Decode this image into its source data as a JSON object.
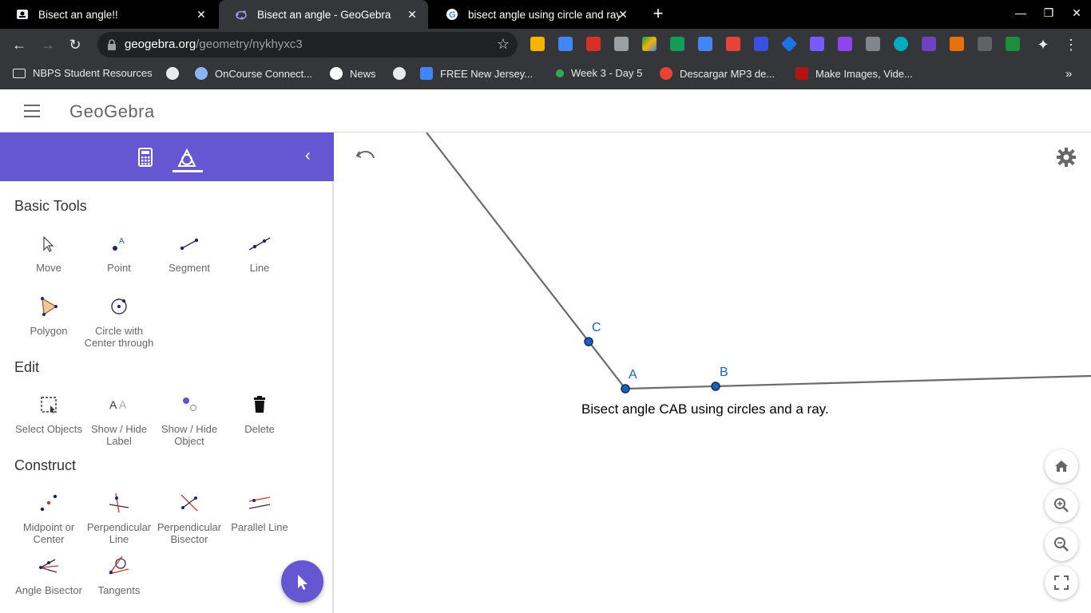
{
  "browser": {
    "tabs": [
      {
        "title": "Bisect an angle!!",
        "active": false
      },
      {
        "title": "Bisect an angle - GeoGebra",
        "active": true
      },
      {
        "title": "bisect angle using circle and ray",
        "active": false
      }
    ],
    "address": {
      "host": "geogebra.org",
      "path": "/geometry/nykhyxc3"
    },
    "bookmarks": [
      {
        "label": "NBPS Student Resources",
        "icon": "folder-icon"
      },
      {
        "label": "",
        "icon": "globe-icon"
      },
      {
        "label": "OnCourse Connect...",
        "icon": "cloud-icon"
      },
      {
        "label": "News",
        "icon": "google-icon"
      },
      {
        "label": "",
        "icon": "globe-icon"
      },
      {
        "label": "FREE New Jersey...",
        "icon": "shield-icon"
      },
      {
        "label": "Week 3 - Day 5",
        "icon": "leaf-icon"
      },
      {
        "label": "Descargar MP3 de...",
        "icon": "music-icon"
      },
      {
        "label": "Make Images, Vide...",
        "icon": "sp-icon"
      }
    ],
    "bookmarks_overflow": "»"
  },
  "app": {
    "logo": "GeoGebra"
  },
  "panel": {
    "sections": [
      {
        "title": "Basic Tools",
        "tools": [
          {
            "label": "Move",
            "icon": "move-icon"
          },
          {
            "label": "Point",
            "icon": "point-icon"
          },
          {
            "label": "Segment",
            "icon": "segment-icon"
          },
          {
            "label": "Line",
            "icon": "line-icon"
          },
          {
            "label": "Polygon",
            "icon": "polygon-icon"
          },
          {
            "label": "Circle with Center through",
            "icon": "circle-icon"
          }
        ]
      },
      {
        "title": "Edit",
        "tools": [
          {
            "label": "Select Objects",
            "icon": "select-icon"
          },
          {
            "label": "Show / Hide Label",
            "icon": "label-icon"
          },
          {
            "label": "Show / Hide Object",
            "icon": "show-hide-icon"
          },
          {
            "label": "Delete",
            "icon": "trash-icon"
          }
        ]
      },
      {
        "title": "Construct",
        "tools": [
          {
            "label": "Midpoint or Center",
            "icon": "midpoint-icon"
          },
          {
            "label": "Perpendicular Line",
            "icon": "perpendicular-icon"
          },
          {
            "label": "Perpendicular Bisector",
            "icon": "perp-bisector-icon"
          },
          {
            "label": "Parallel Line",
            "icon": "parallel-icon"
          },
          {
            "label": "Angle Bisector",
            "icon": "angle-bisector-icon"
          },
          {
            "label": "Tangents",
            "icon": "tangents-icon"
          }
        ]
      }
    ]
  },
  "canvas": {
    "points": [
      {
        "label": "C"
      },
      {
        "label": "A"
      },
      {
        "label": "B"
      }
    ],
    "caption": "Bisect angle CAB using circles and a ray."
  },
  "colors": {
    "accent": "#6557d2",
    "point": "#1565c0"
  }
}
